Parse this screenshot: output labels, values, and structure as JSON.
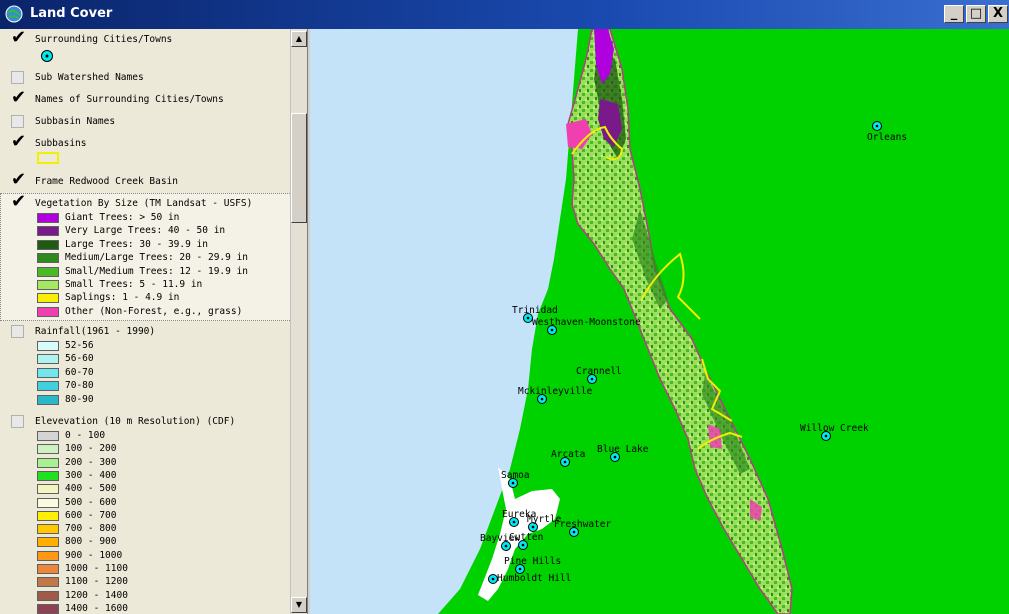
{
  "window": {
    "title": "Land Cover",
    "minimize": "_",
    "maximize": "□",
    "close": "X"
  },
  "toc": {
    "layers": [
      {
        "name": "Surrounding Cities/Towns",
        "checked": true
      },
      {
        "name": "Sub Watershed Names",
        "checked": false
      },
      {
        "name": "Names of Surrounding Cities/Towns",
        "checked": true
      },
      {
        "name": "Subbasin Names",
        "checked": false
      },
      {
        "name": "Subbasins",
        "checked": true
      },
      {
        "name": "Frame Redwood Creek Basin",
        "checked": true
      },
      {
        "name": "Vegetation By Size (TM Landsat - USFS)",
        "checked": true
      },
      {
        "name": "Rainfall(1961 - 1990)",
        "checked": false
      },
      {
        "name": "Elevevation (10 m Resolution) (CDF)",
        "checked": false
      }
    ],
    "vegetation_classes": [
      {
        "label": "Giant Trees: > 50 in",
        "color": "#b000e0"
      },
      {
        "label": "Very Large Trees: 40 - 50 in",
        "color": "#7a1a8a"
      },
      {
        "label": "Large Trees: 30 - 39.9 in",
        "color": "#1e5a10"
      },
      {
        "label": "Medium/Large Trees: 20 - 29.9 in",
        "color": "#2f8a1c"
      },
      {
        "label": "Small/Medium Trees: 12 - 19.9 in",
        "color": "#4cb828"
      },
      {
        "label": "Small Trees: 5 - 11.9 in",
        "color": "#a6e860"
      },
      {
        "label": "Saplings: 1 - 4.9 in",
        "color": "#f8f000"
      },
      {
        "label": "Other (Non-Forest, e.g., grass)",
        "color": "#f040b0"
      }
    ],
    "rainfall_classes": [
      {
        "label": "52-56",
        "color": "#d8fafa"
      },
      {
        "label": "56-60",
        "color": "#b0f2f2"
      },
      {
        "label": "60-70",
        "color": "#70e6ee"
      },
      {
        "label": "70-80",
        "color": "#40d0e0"
      },
      {
        "label": "80-90",
        "color": "#28b8c8"
      }
    ],
    "elevation_classes": [
      {
        "label": "0 - 100",
        "color": "#d4d4d4"
      },
      {
        "label": "100 - 200",
        "color": "#cff0c0"
      },
      {
        "label": "200 - 300",
        "color": "#a8f090"
      },
      {
        "label": "300 - 400",
        "color": "#20e020"
      },
      {
        "label": "400 - 500",
        "color": "#f4f4c0"
      },
      {
        "label": "500 - 600",
        "color": "#fafae0"
      },
      {
        "label": "600 - 700",
        "color": "#fff000"
      },
      {
        "label": "700 - 800",
        "color": "#ffc800"
      },
      {
        "label": "800 - 900",
        "color": "#ffb000"
      },
      {
        "label": "900 - 1000",
        "color": "#ff9818"
      },
      {
        "label": "1000 - 1100",
        "color": "#e88838"
      },
      {
        "label": "1100 - 1200",
        "color": "#c0784a"
      },
      {
        "label": "1200 - 1400",
        "color": "#a05a48"
      },
      {
        "label": "1400 - 1600",
        "color": "#904050"
      }
    ]
  },
  "map": {
    "colors": {
      "ocean": "#c4e2f8",
      "land": "#00d200",
      "bay": "#ffffff",
      "subbasin_line": "#f0f000",
      "town_marker": "#00e8f0"
    },
    "towns": [
      {
        "name": "Orleans"
      },
      {
        "name": "Trinidad"
      },
      {
        "name": "Westhaven-Moonstone"
      },
      {
        "name": "Crannell"
      },
      {
        "name": "Mckinleyville"
      },
      {
        "name": "Willow Creek"
      },
      {
        "name": "Arcata"
      },
      {
        "name": "Blue Lake"
      },
      {
        "name": "Samoa"
      },
      {
        "name": "Eureka"
      },
      {
        "name": "Myrtle"
      },
      {
        "name": "Freshwater"
      },
      {
        "name": "Bayview"
      },
      {
        "name": "Cutten"
      },
      {
        "name": "Pine Hills"
      },
      {
        "name": "Humboldt Hill"
      }
    ]
  }
}
